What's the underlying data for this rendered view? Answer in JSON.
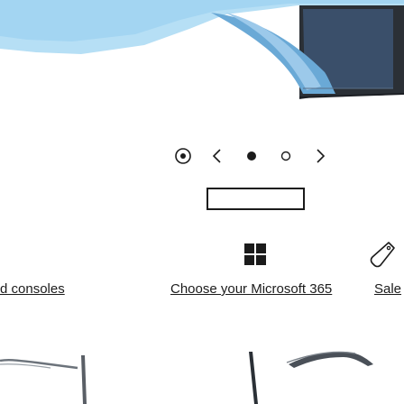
{
  "carousel": {
    "pause_icon": "pause-icon",
    "prev_icon": "chevron-left-icon",
    "next_icon": "chevron-right-icon",
    "slides": [
      {
        "state": "active"
      },
      {
        "state": "inactive"
      }
    ]
  },
  "tiles": {
    "items": [
      {
        "label": "d consoles",
        "icon": "console-icon"
      },
      {
        "label": "Choose your Microsoft 365",
        "icon": "windows-logo-icon"
      },
      {
        "label": "Sale",
        "icon": "price-tag-icon"
      }
    ]
  },
  "colors": {
    "text": "#1b1b1b",
    "hero_bg": "#b6dff5",
    "device_frame": "#2b3036"
  }
}
